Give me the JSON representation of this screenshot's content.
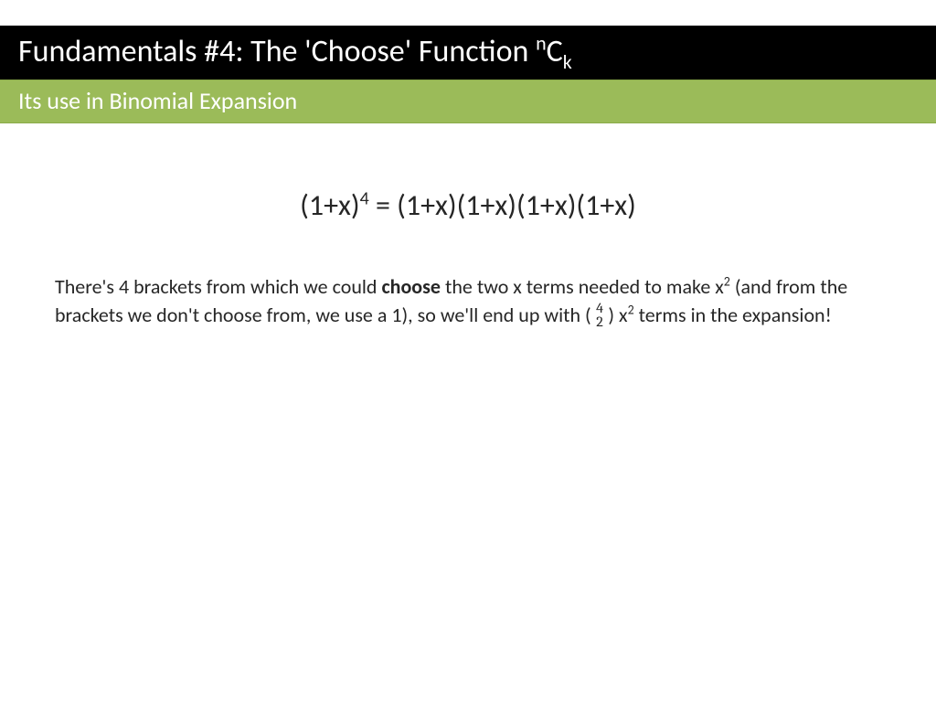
{
  "title": {
    "prefix": "Fundamentals #4: The 'Choose' Function ",
    "sup": "n",
    "mid": "C",
    "sub": "k"
  },
  "subtitle": "Its use in Binomial Expansion",
  "equation": {
    "lhs_base": "(1+x)",
    "lhs_exp": "4",
    "rhs": " = (1+x)(1+x)(1+x)(1+x)"
  },
  "paragraph": {
    "t1": "There's 4 brackets from which we could ",
    "bold": "choose",
    "t2": " the two x terms needed to make x",
    "exp2a": "2",
    "t3": " (and from the brackets we don't choose from, we use a 1), so we'll end up with (",
    "binom_top": "4",
    "binom_bot": "2",
    "t4": ") x",
    "exp2b": "2",
    "t5": " terms in the expansion!"
  }
}
